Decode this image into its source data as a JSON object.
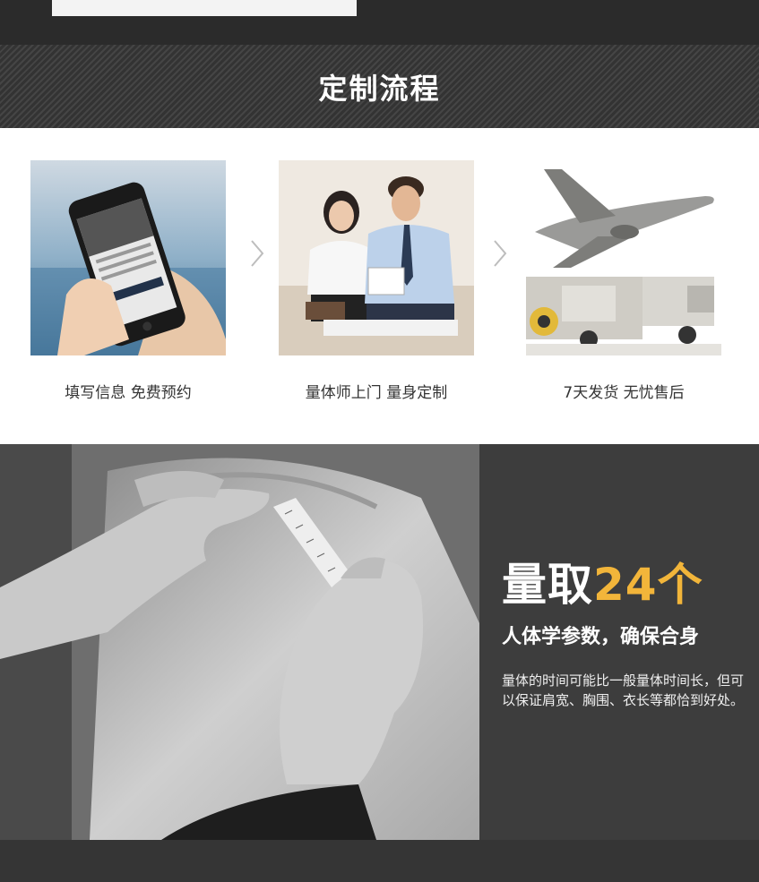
{
  "section_title": "定制流程",
  "steps": [
    {
      "caption": "填写信息 免费预约",
      "image": "phone-booking-photo"
    },
    {
      "caption": "量体师上门 量身定制",
      "image": "tailor-consultation-photo"
    },
    {
      "caption": "7天发货 无忧售后",
      "image": "shipping-photo"
    }
  ],
  "measure": {
    "headline_prefix": "量取",
    "headline_accent": "24个",
    "subheadline": "人体学参数，确保合身",
    "description": "量体的时间可能比一般量体时间长，但可以保证肩宽、胸围、衣长等都恰到好处。"
  },
  "colors": {
    "accent": "#f2b53a",
    "dark_bg": "#3d3d3d",
    "title_band": "#3b3b3b"
  }
}
